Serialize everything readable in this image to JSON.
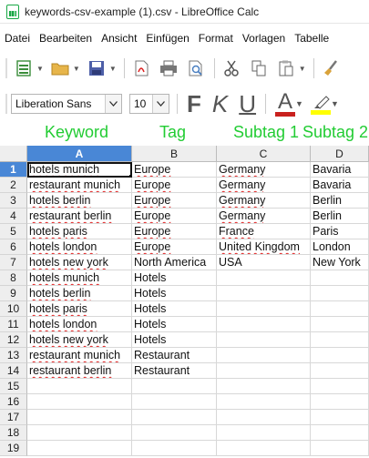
{
  "window": {
    "title": "keywords-csv-example (1).csv - LibreOffice Calc"
  },
  "menu": [
    "Datei",
    "Bearbeiten",
    "Ansicht",
    "Einfügen",
    "Format",
    "Vorlagen",
    "Tabelle"
  ],
  "toolbar": {
    "font_name": "Liberation Sans",
    "font_size": "10",
    "bold": "F",
    "italic": "K",
    "underline": "U",
    "font_color": "A",
    "font_color_hex": "#c9211e",
    "highlight_hex": "#ffff00"
  },
  "overlay": {
    "keyword": "Keyword",
    "tag": "Tag",
    "subtag1": "Subtag 1",
    "subtag2": "Subtag 2",
    "color": "#22cc33"
  },
  "sheet": {
    "columns": [
      "A",
      "B",
      "C",
      "D"
    ],
    "active_cell": "A1",
    "rows": [
      {
        "num": "1",
        "cells": [
          "hotels munich",
          "Europe",
          "Germany",
          "Bavaria"
        ]
      },
      {
        "num": "2",
        "cells": [
          "restaurant munich",
          "Europe",
          "Germany",
          "Bavaria"
        ]
      },
      {
        "num": "3",
        "cells": [
          "hotels berlin",
          "Europe",
          "Germany",
          "Berlin"
        ]
      },
      {
        "num": "4",
        "cells": [
          "restaurant berlin",
          "Europe",
          "Germany",
          "Berlin"
        ]
      },
      {
        "num": "5",
        "cells": [
          "hotels paris",
          "Europe",
          "France",
          "Paris"
        ]
      },
      {
        "num": "6",
        "cells": [
          "hotels london",
          "Europe",
          "United Kingdom",
          "London"
        ]
      },
      {
        "num": "7",
        "cells": [
          "hotels new york",
          "North America",
          "USA",
          "New York"
        ]
      },
      {
        "num": "8",
        "cells": [
          "hotels munich",
          "Hotels",
          "",
          ""
        ]
      },
      {
        "num": "9",
        "cells": [
          "hotels berlin",
          "Hotels",
          "",
          ""
        ]
      },
      {
        "num": "10",
        "cells": [
          "hotels paris",
          "Hotels",
          "",
          ""
        ]
      },
      {
        "num": "11",
        "cells": [
          "hotels london",
          "Hotels",
          "",
          ""
        ]
      },
      {
        "num": "12",
        "cells": [
          "hotels new york",
          "Hotels",
          "",
          ""
        ]
      },
      {
        "num": "13",
        "cells": [
          "restaurant munich",
          "Restaurant",
          "",
          ""
        ]
      },
      {
        "num": "14",
        "cells": [
          "restaurant berlin",
          "Restaurant",
          "",
          ""
        ]
      },
      {
        "num": "15",
        "cells": [
          "",
          "",
          "",
          ""
        ]
      },
      {
        "num": "16",
        "cells": [
          "",
          "",
          "",
          ""
        ]
      },
      {
        "num": "17",
        "cells": [
          "",
          "",
          "",
          ""
        ]
      },
      {
        "num": "18",
        "cells": [
          "",
          "",
          "",
          ""
        ]
      },
      {
        "num": "19",
        "cells": [
          "",
          "",
          "",
          ""
        ]
      }
    ]
  }
}
